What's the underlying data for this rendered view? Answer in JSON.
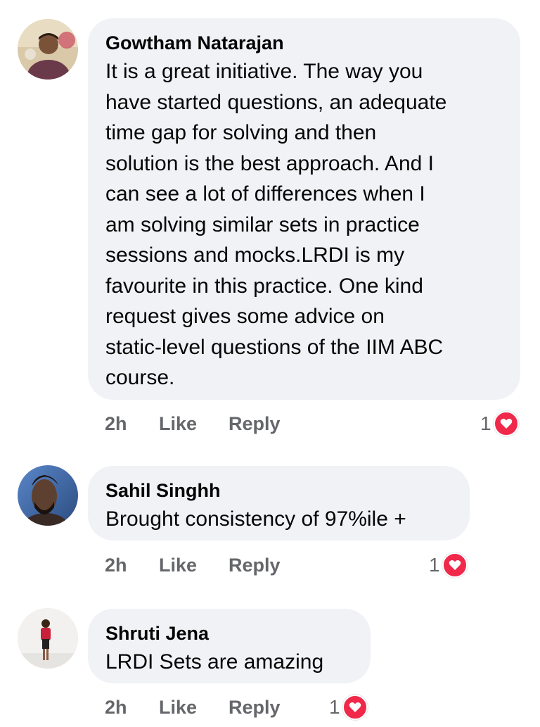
{
  "comments": [
    {
      "author": "Gowtham Natarajan",
      "text": "It is a great initiative. The way you\nhave started questions, an adequate\ntime gap for solving and then\nsolution is the best approach. And I\ncan see a lot of differences when I\nam solving similar sets in practice\nsessions and mocks.LRDI is my\nfavourite in this practice. One kind\nrequest gives some advice on\nstatic-level questions of the IIM ABC\ncourse.",
      "time": "2h",
      "like_label": "Like",
      "reply_label": "Reply",
      "reaction_count": "1",
      "reaction_icon": "heart-icon"
    },
    {
      "author": "Sahil Singhh",
      "text": "Brought consistency of 97%ile +",
      "time": "2h",
      "like_label": "Like",
      "reply_label": "Reply",
      "reaction_count": "1",
      "reaction_icon": "heart-icon"
    },
    {
      "author": "Shruti Jena",
      "text": "LRDI Sets are amazing",
      "time": "2h",
      "like_label": "Like",
      "reply_label": "Reply",
      "reaction_count": "1",
      "reaction_icon": "heart-icon"
    }
  ],
  "colors": {
    "bubble": "#f0f2f5",
    "secondary_text": "#65676b",
    "primary_text": "#050505",
    "love_reaction": "#f02849"
  }
}
